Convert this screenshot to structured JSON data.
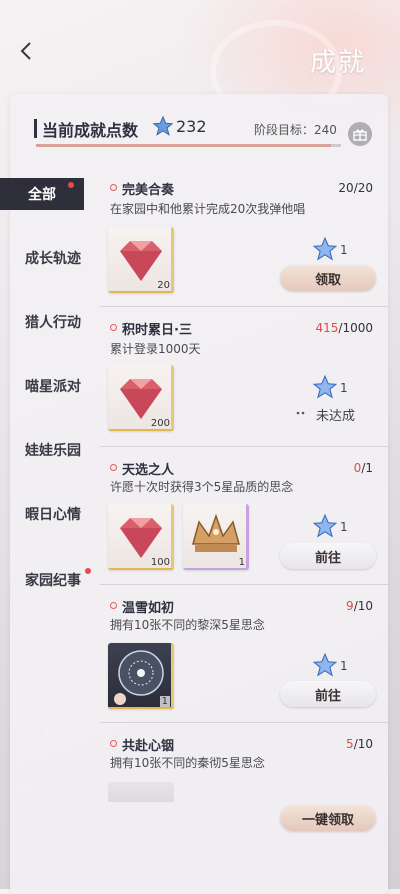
{
  "header": {
    "title": "成就",
    "back_icon": "chevron-left-icon"
  },
  "summary": {
    "label": "当前成就点数",
    "points": "232",
    "stage_label": "阶段目标：240",
    "progress_fraction": 0.967,
    "gift_icon": "gift-icon"
  },
  "sidebar": {
    "items": [
      {
        "label": "全部",
        "active": true,
        "dot": true
      },
      {
        "label": "成长轨迹",
        "active": false,
        "dot": false
      },
      {
        "label": "猎人行动",
        "active": false,
        "dot": false
      },
      {
        "label": "喵星派对",
        "active": false,
        "dot": false
      },
      {
        "label": "娃娃乐园",
        "active": false,
        "dot": false
      },
      {
        "label": "暇日心情",
        "active": false,
        "dot": false
      },
      {
        "label": "家园纪事",
        "active": false,
        "dot": true
      }
    ]
  },
  "cards": [
    {
      "title": "完美合奏",
      "progress": "20",
      "goal": "/20",
      "desc": "在家园中和他累计完成20次我弹他唱",
      "items": [
        {
          "icon": "red-diamond-icon",
          "qty": "20"
        }
      ],
      "reward": "1",
      "action": "领取",
      "action_type": "claim"
    },
    {
      "title": "积时累日·三",
      "progress": "415",
      "goal": "/1000",
      "desc": "累计登录1000天",
      "items": [
        {
          "icon": "red-diamond-icon",
          "qty": "200"
        }
      ],
      "reward": "1",
      "action": "未达成",
      "action_type": "none"
    },
    {
      "title": "天选之人",
      "progress": "0",
      "goal": "/1",
      "desc": "许愿十次时获得3个5星品质的思念",
      "items": [
        {
          "icon": "red-diamond-icon",
          "qty": "100"
        },
        {
          "icon": "golden-crown-icon",
          "qty": "1"
        }
      ],
      "reward": "1",
      "action": "前往",
      "action_type": "go"
    },
    {
      "title": "温雪如初",
      "progress": "9",
      "goal": "/10",
      "desc": "拥有10张不同的黎深5星思念",
      "items": [
        {
          "icon": "snow-orb-icon",
          "qty": "1"
        }
      ],
      "reward": "1",
      "action": "前往",
      "action_type": "go"
    },
    {
      "title": "共赴心铟",
      "progress": "5",
      "goal": "/10",
      "desc": "拥有10张不同的秦彻5星思念",
      "items": [],
      "reward": "",
      "action": "",
      "action_type": "none"
    }
  ],
  "claim_all": {
    "label": "一键领取"
  },
  "colors": {
    "accent_red": "#e24b4b",
    "star_blue": "#5d8fd8",
    "dark": "#2e2f3a"
  }
}
